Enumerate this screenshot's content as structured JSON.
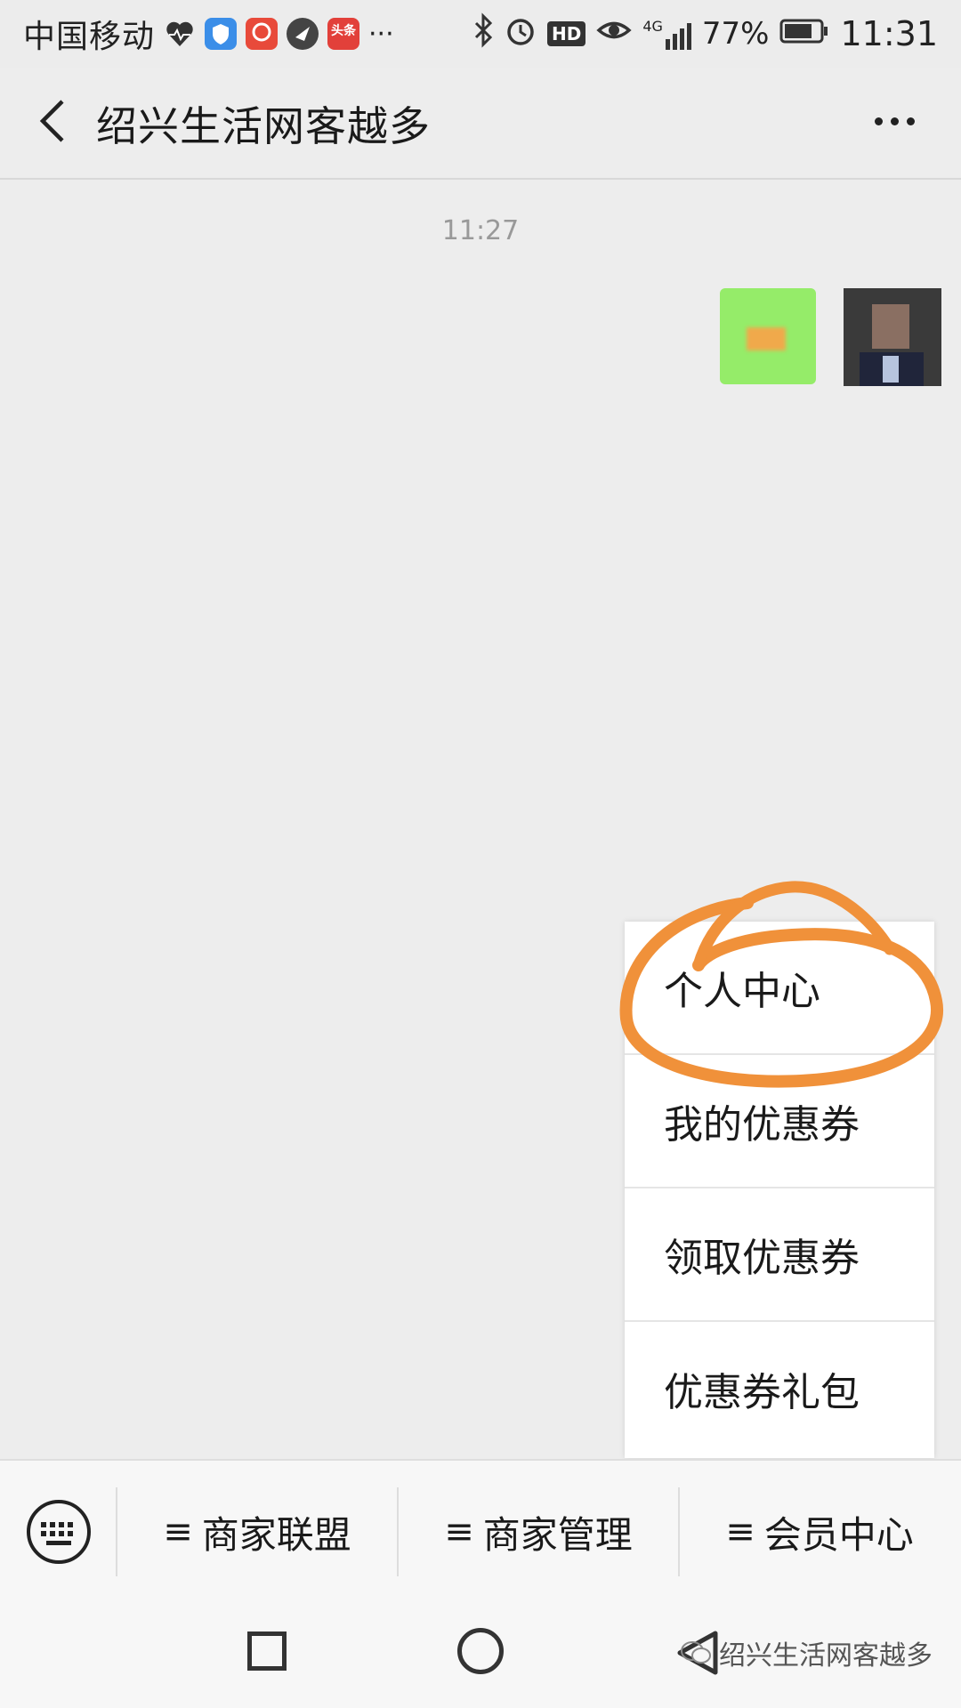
{
  "status_bar": {
    "carrier": "中国移动",
    "dots": "···",
    "network": "4G",
    "battery": "77%",
    "time": "11:31",
    "hd_badge": "HD",
    "news_badge": "头条"
  },
  "header": {
    "title": "绍兴生活网客越多"
  },
  "chat": {
    "timestamp": "11:27"
  },
  "popup_menu": {
    "items": [
      {
        "label": "个人中心"
      },
      {
        "label": "我的优惠券"
      },
      {
        "label": "领取优惠券"
      },
      {
        "label": "优惠券礼包"
      }
    ]
  },
  "bottom_menu": {
    "items": [
      {
        "label": "商家联盟"
      },
      {
        "label": "商家管理"
      },
      {
        "label": "会员中心"
      }
    ],
    "menu_glyph": "≡"
  },
  "watermark": {
    "text": "绍兴生活网客越多"
  },
  "colors": {
    "bubble_green": "#95ec69",
    "annotation_orange": "#f0913a",
    "background": "#ededed"
  }
}
